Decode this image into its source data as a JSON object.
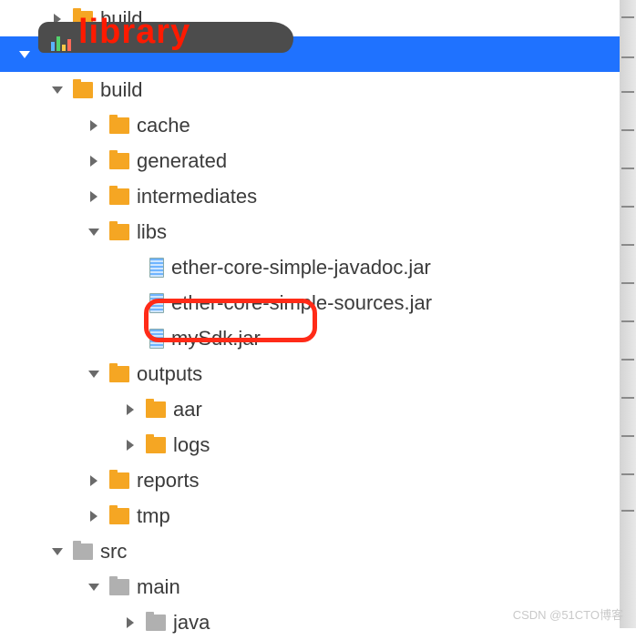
{
  "annotations": {
    "library_label": "library",
    "watermark": "CSDN @51CTO博客"
  },
  "highlight": {
    "target": "mySdk.jar"
  },
  "tree": {
    "root_build": {
      "label": "build"
    },
    "library": {
      "label": "library",
      "selected": true
    },
    "build": {
      "label": "build"
    },
    "cache": {
      "label": "cache"
    },
    "generated": {
      "label": "generated"
    },
    "intermediates": {
      "label": "intermediates"
    },
    "libs": {
      "label": "libs"
    },
    "jar1": {
      "label": "ether-core-simple-javadoc.jar"
    },
    "jar2": {
      "label": "ether-core-simple-sources.jar"
    },
    "jar3": {
      "label": "mySdk.jar"
    },
    "outputs": {
      "label": "outputs"
    },
    "aar": {
      "label": "aar"
    },
    "logs": {
      "label": "logs"
    },
    "reports": {
      "label": "reports"
    },
    "tmp": {
      "label": "tmp"
    },
    "src": {
      "label": "src"
    },
    "main": {
      "label": "main"
    },
    "java": {
      "label": "java"
    }
  }
}
